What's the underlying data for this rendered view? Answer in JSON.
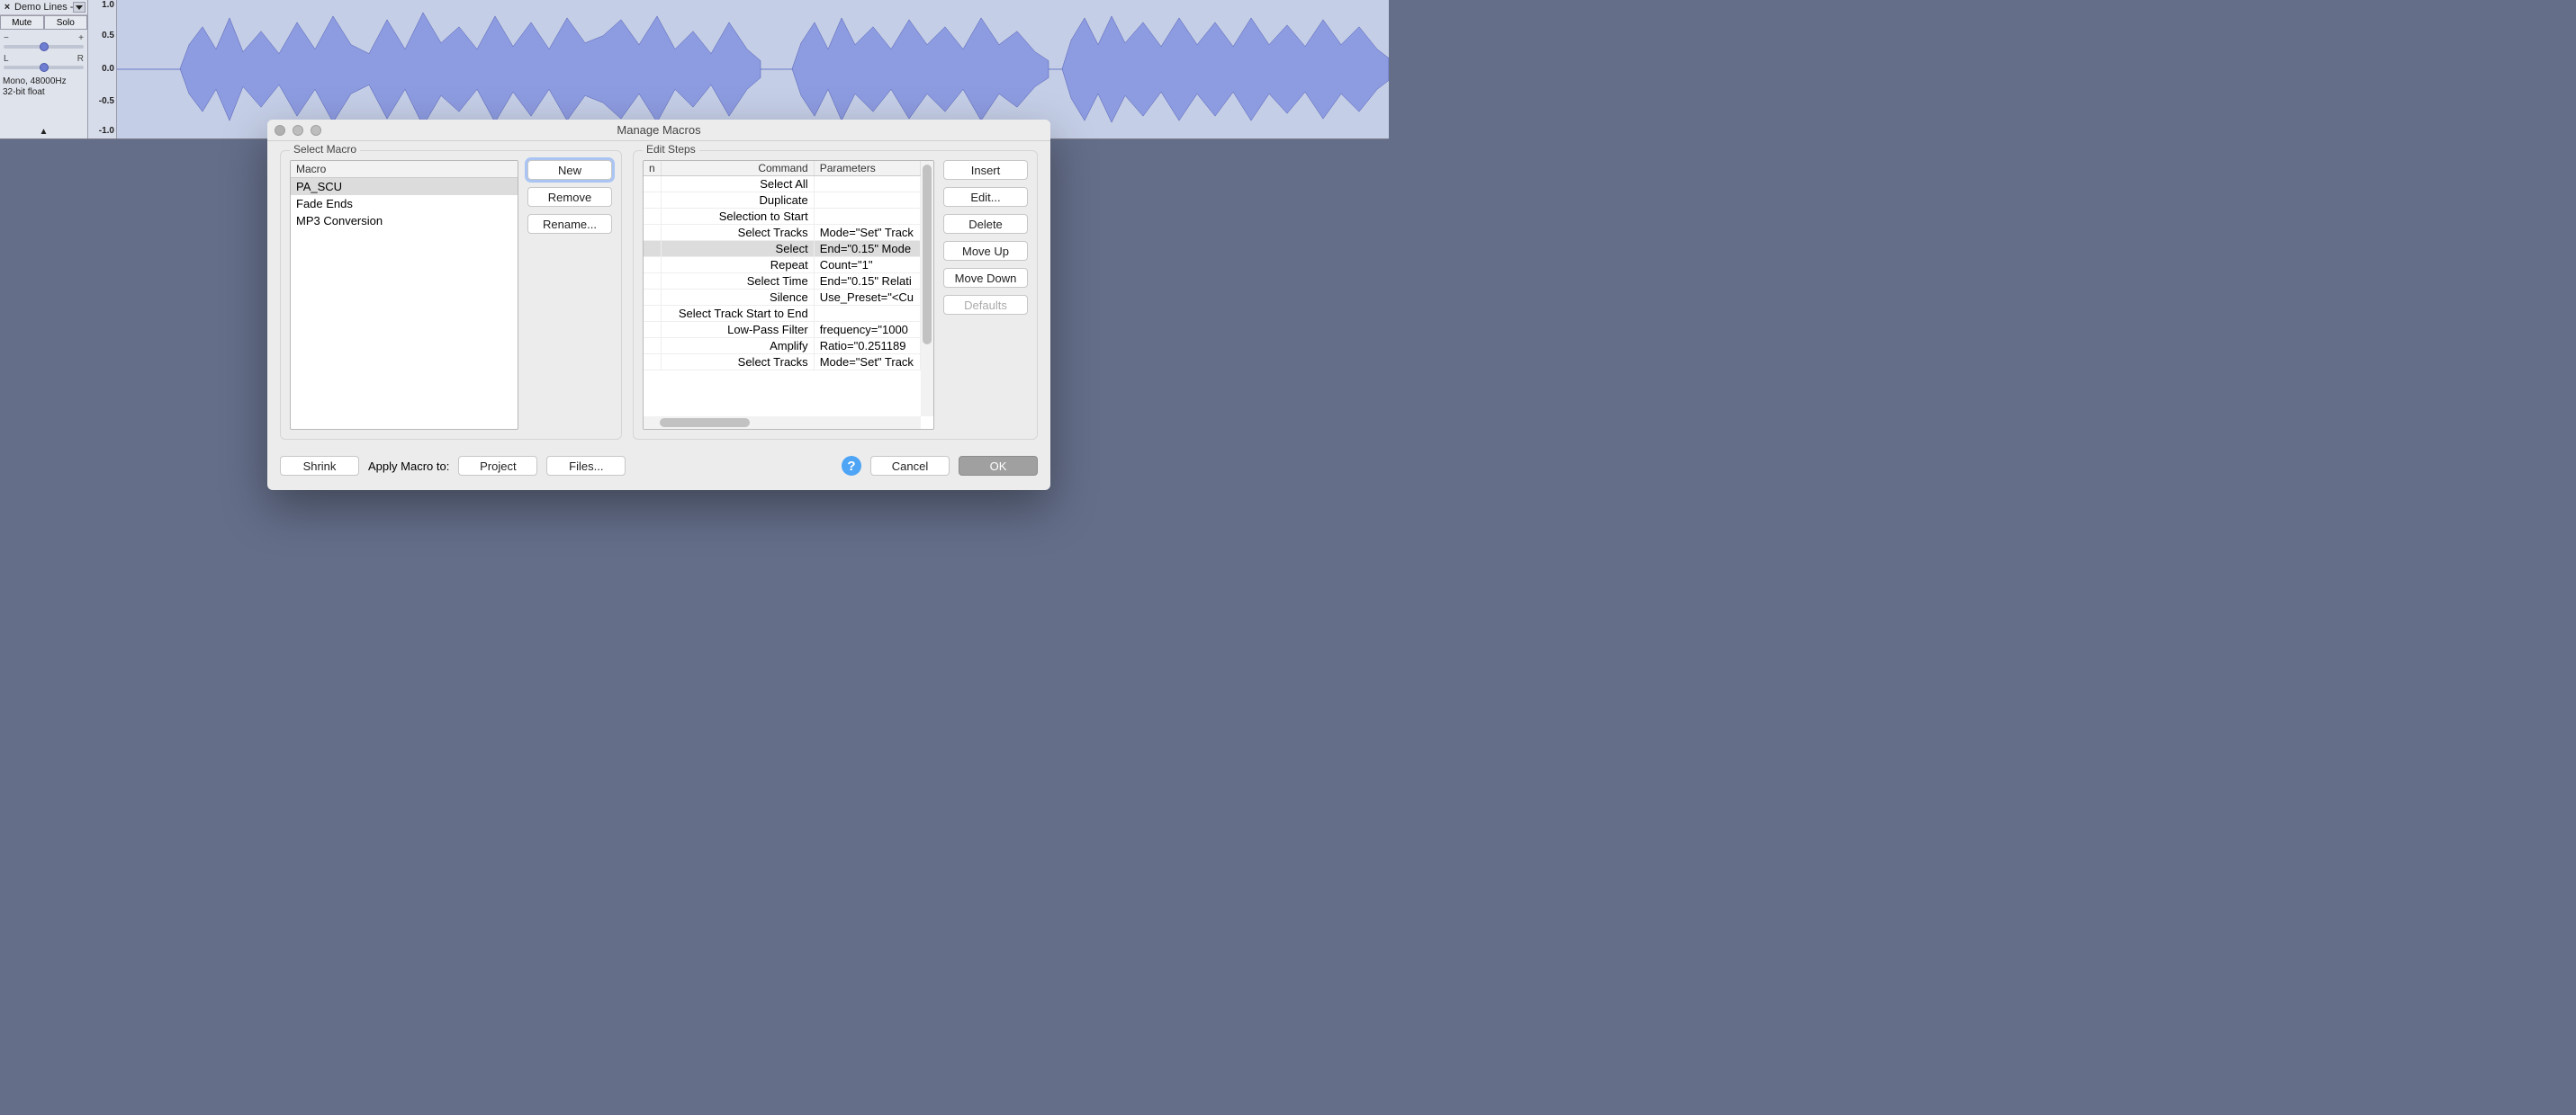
{
  "track": {
    "name": "Demo Lines -",
    "mute": "Mute",
    "solo": "Solo",
    "gainL": "−",
    "gainR": "+",
    "panL": "L",
    "panR": "R",
    "meta1": "Mono, 48000Hz",
    "meta2": "32-bit float",
    "axis": [
      "1.0",
      "0.5",
      "0.0",
      "-0.5",
      "-1.0"
    ]
  },
  "dialog": {
    "title": "Manage Macros",
    "selectMacro": {
      "label": "Select Macro",
      "header": "Macro",
      "items": [
        "PA_SCU",
        "Fade Ends",
        "MP3 Conversion"
      ],
      "selectedIndex": 0,
      "buttons": {
        "new": "New",
        "remove": "Remove",
        "rename": "Rename..."
      }
    },
    "editSteps": {
      "label": "Edit Steps",
      "colFirst": "n",
      "colCommand": "Command",
      "colParameters": "Parameters",
      "rows": [
        {
          "cmd": "Select All",
          "params": ""
        },
        {
          "cmd": "Duplicate",
          "params": ""
        },
        {
          "cmd": "Selection to Start",
          "params": ""
        },
        {
          "cmd": "Select Tracks",
          "params": "Mode=\"Set\" Track"
        },
        {
          "cmd": "Select",
          "params": "End=\"0.15\" Mode"
        },
        {
          "cmd": "Repeat",
          "params": "Count=\"1\""
        },
        {
          "cmd": "Select Time",
          "params": "End=\"0.15\" Relati"
        },
        {
          "cmd": "Silence",
          "params": "Use_Preset=\"<Cu"
        },
        {
          "cmd": "Select Track Start to End",
          "params": ""
        },
        {
          "cmd": "Low-Pass Filter",
          "params": "frequency=\"1000"
        },
        {
          "cmd": "Amplify",
          "params": "Ratio=\"0.251189"
        },
        {
          "cmd": "Select Tracks",
          "params": "Mode=\"Set\" Track"
        }
      ],
      "selectedIndex": 4,
      "buttons": {
        "insert": "Insert",
        "edit": "Edit...",
        "delete": "Delete",
        "moveUp": "Move Up",
        "moveDown": "Move Down",
        "defaults": "Defaults"
      }
    },
    "footer": {
      "shrink": "Shrink",
      "applyLabel": "Apply Macro to:",
      "project": "Project",
      "files": "Files...",
      "cancel": "Cancel",
      "ok": "OK"
    }
  }
}
